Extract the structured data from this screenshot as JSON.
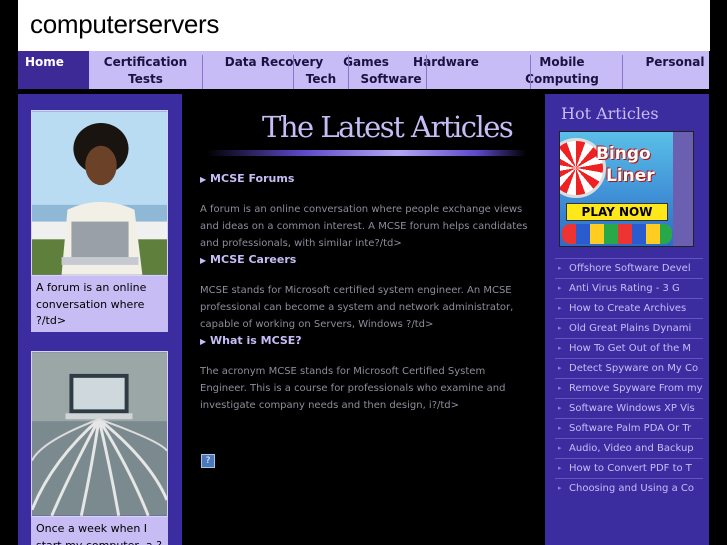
{
  "header": {
    "site_title": "computerservers"
  },
  "nav": [
    {
      "label": "Home"
    },
    {
      "label": "Certification Tests"
    },
    {
      "label": "Data Recovery"
    },
    {
      "label": "Games"
    },
    {
      "label": "Hardware"
    },
    {
      "label": "Mobile Computing"
    },
    {
      "label": "Personal"
    },
    {
      "label": "Tech"
    },
    {
      "label": "Software"
    }
  ],
  "left_promos": [
    {
      "caption": "A forum is an online conversation where ?/td>"
    },
    {
      "caption": "Once a week when I start my computer, a ?"
    }
  ],
  "main": {
    "banner_title": "The Latest Articles",
    "articles": [
      {
        "title": "MCSE Forums",
        "body": "A forum is an online conversation where people exchange views and ideas on a common interest. A MCSE forum helps candidates and professionals, with similar inte?/td>"
      },
      {
        "title": "MCSE Careers",
        "body": "MCSE stands for Microsoft certified system engineer. An MCSE professional can become a system and network administrator, capable of working on Servers, Windows ?/td>"
      },
      {
        "title": "What is MCSE?",
        "body": "The acronym MCSE stands for Microsoft Certified System Engineer. This is a course for professionals who examine and investigate company needs and then design, i?/td>"
      }
    ],
    "icon_glyph": "?"
  },
  "right": {
    "title": "Hot Articles",
    "ad": {
      "line1": "Bingo",
      "line2": "Liner",
      "button": "PLAY NOW"
    },
    "items": [
      "Offshore Software Devel",
      "Anti Virus Rating - 3 G",
      "How to Create Archives",
      "Old Great Plains Dynami",
      "How To Get Out of the M",
      "Detect Spyware on My Co",
      "Remove Spyware From my",
      "Software Windows XP Vis",
      "Software Palm PDA Or Tr",
      "Audio, Video and Backup",
      "How to Convert PDF to T",
      "Choosing and Using a Co"
    ]
  },
  "colors": {
    "nav_bg": "#c8bcf6",
    "nav_active": "#3e2a96",
    "sidebar_bg": "#3b2ca0",
    "text_light": "#c8bcf6"
  }
}
